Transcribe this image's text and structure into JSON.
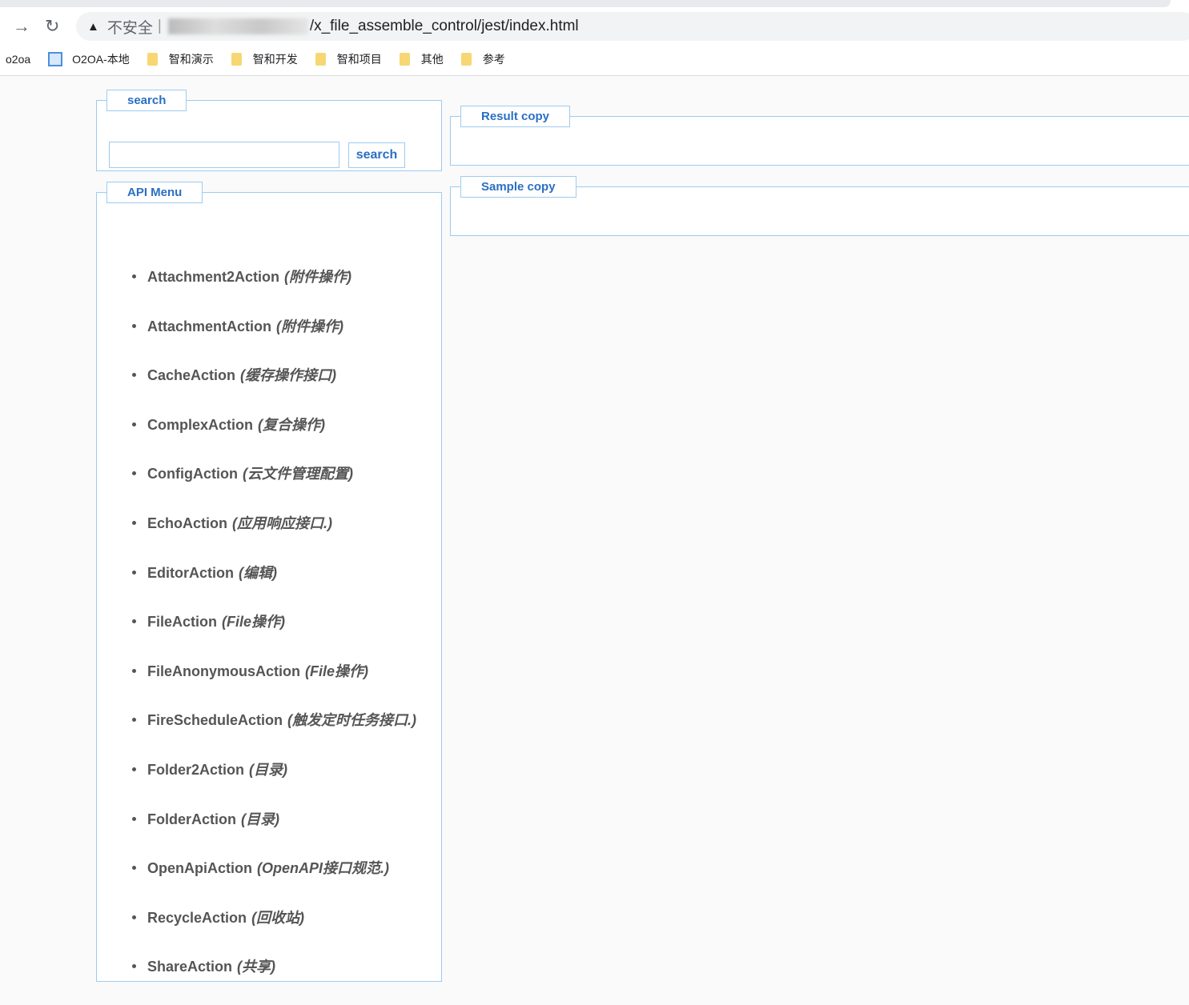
{
  "browser": {
    "security_label": "不安全",
    "url_visible": "/x_file_assemble_control/jest/index.html"
  },
  "bookmarks": [
    {
      "label": "o2oa",
      "icon": "none"
    },
    {
      "label": "O2OA-本地",
      "icon": "site-icon"
    },
    {
      "label": "智和演示",
      "icon": "folder-icon"
    },
    {
      "label": "智和开发",
      "icon": "folder-icon"
    },
    {
      "label": "智和项目",
      "icon": "folder-icon"
    },
    {
      "label": "其他",
      "icon": "folder-icon"
    },
    {
      "label": "参考",
      "icon": "folder-icon"
    }
  ],
  "search": {
    "legend": "search",
    "value": "",
    "button": "search"
  },
  "menu": {
    "legend": "API Menu",
    "items": [
      {
        "name": "Attachment2Action",
        "desc": "(附件操作)"
      },
      {
        "name": "AttachmentAction",
        "desc": "(附件操作)"
      },
      {
        "name": "CacheAction",
        "desc": "(缓存操作接口)"
      },
      {
        "name": "ComplexAction",
        "desc": "(复合操作)"
      },
      {
        "name": "ConfigAction",
        "desc": "(云文件管理配置)"
      },
      {
        "name": "EchoAction",
        "desc": "(应用响应接口.)"
      },
      {
        "name": "EditorAction",
        "desc": "(编辑)"
      },
      {
        "name": "FileAction",
        "desc": "(File操作)"
      },
      {
        "name": "FileAnonymousAction",
        "desc": "(File操作)"
      },
      {
        "name": "FireScheduleAction",
        "desc": "(触发定时任务接口.)"
      },
      {
        "name": "Folder2Action",
        "desc": "(目录)"
      },
      {
        "name": "FolderAction",
        "desc": "(目录)"
      },
      {
        "name": "OpenApiAction",
        "desc": "(OpenAPI接口规范.)"
      },
      {
        "name": "RecycleAction",
        "desc": "(回收站)"
      },
      {
        "name": "ShareAction",
        "desc": "(共享)"
      }
    ]
  },
  "result": {
    "legend": "Result copy"
  },
  "sample": {
    "legend": "Sample copy"
  }
}
